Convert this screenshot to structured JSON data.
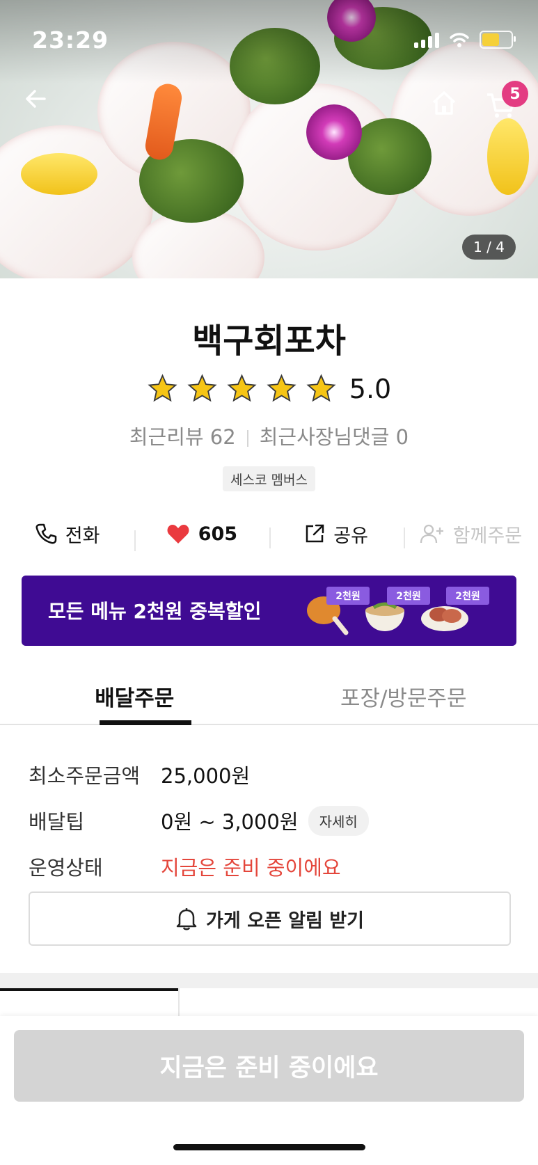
{
  "status_bar": {
    "time": "23:29"
  },
  "hero": {
    "page_indicator": "1 / 4",
    "cart_count": "5",
    "icons": {
      "back": "back-arrow-icon",
      "home": "home-icon",
      "cart": "cart-icon"
    }
  },
  "store": {
    "name": "백구회포차",
    "rating": "5.0",
    "stars": 5,
    "recent_reviews": "최근리뷰 62",
    "owner_replies": "최근사장님댓글 0",
    "member_badge": "세스코 멤버스"
  },
  "actions": {
    "call": "전화",
    "likes": "605",
    "share": "공유",
    "group_order": "함께주문"
  },
  "promo": {
    "text": "모든 메뉴 2천원 중복할인",
    "tag": "2천원",
    "bg_color": "#3f0b93"
  },
  "order_tabs": [
    {
      "label": "배달주문",
      "active": true
    },
    {
      "label": "포장/방문주문",
      "active": false
    }
  ],
  "info": {
    "min_order_label": "최소주문금액",
    "min_order_value": "25,000원",
    "delivery_tip_label": "배달팁",
    "delivery_tip_value": "0원 ~ 3,000원",
    "detail_button": "자세히",
    "status_label": "운영상태",
    "status_value": "지금은 준비 중이에요",
    "status_color": "#e4463b"
  },
  "notify_button": "가게 오픈 알림 받기",
  "bottom_cta": "지금은 준비 중이에요"
}
